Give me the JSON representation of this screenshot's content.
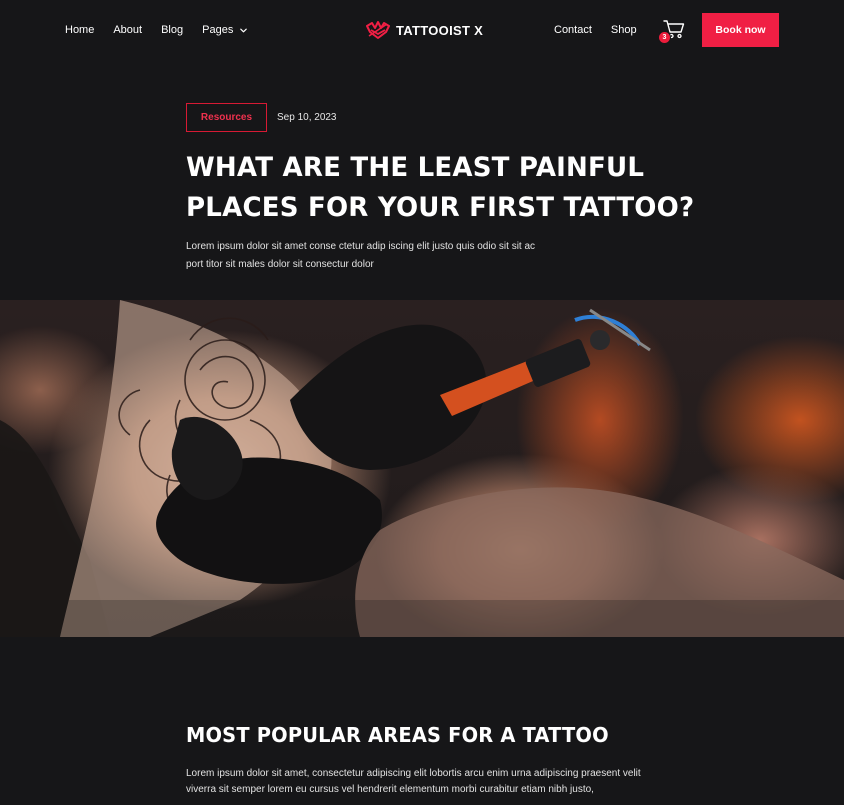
{
  "nav": {
    "home": "Home",
    "about": "About",
    "blog": "Blog",
    "pages": "Pages",
    "contact": "Contact",
    "shop": "Shop",
    "cart_count": "3",
    "book_label": "Book now"
  },
  "brand": {
    "name": "TATTOOIST X",
    "accent": "#f01f44"
  },
  "post": {
    "category": "Resources",
    "date": "Sep 10, 2023",
    "title": "WHAT ARE THE LEAST PAINFUL PLACES FOR YOUR FIRST TATTOO?",
    "intro": "Lorem ipsum dolor sit amet conse ctetur adip iscing elit justo quis odio sit sit ac port titor sit males dolor sit consectur dolor"
  },
  "section": {
    "title": "MOST POPULAR AREAS FOR A TATTOO",
    "body": "Lorem ipsum dolor sit amet, consectetur adipiscing elit lobortis arcu enim urna adipiscing praesent velit viverra sit semper lorem eu cursus vel hendrerit elementum morbi curabitur etiam nibh justo,"
  },
  "colors": {
    "background": "#161618",
    "accent": "#f01f44",
    "text": "#ffffff"
  },
  "icons": {
    "cart": "cart-icon",
    "chevron": "chevron-down-icon",
    "logo": "logo-mark-icon"
  }
}
